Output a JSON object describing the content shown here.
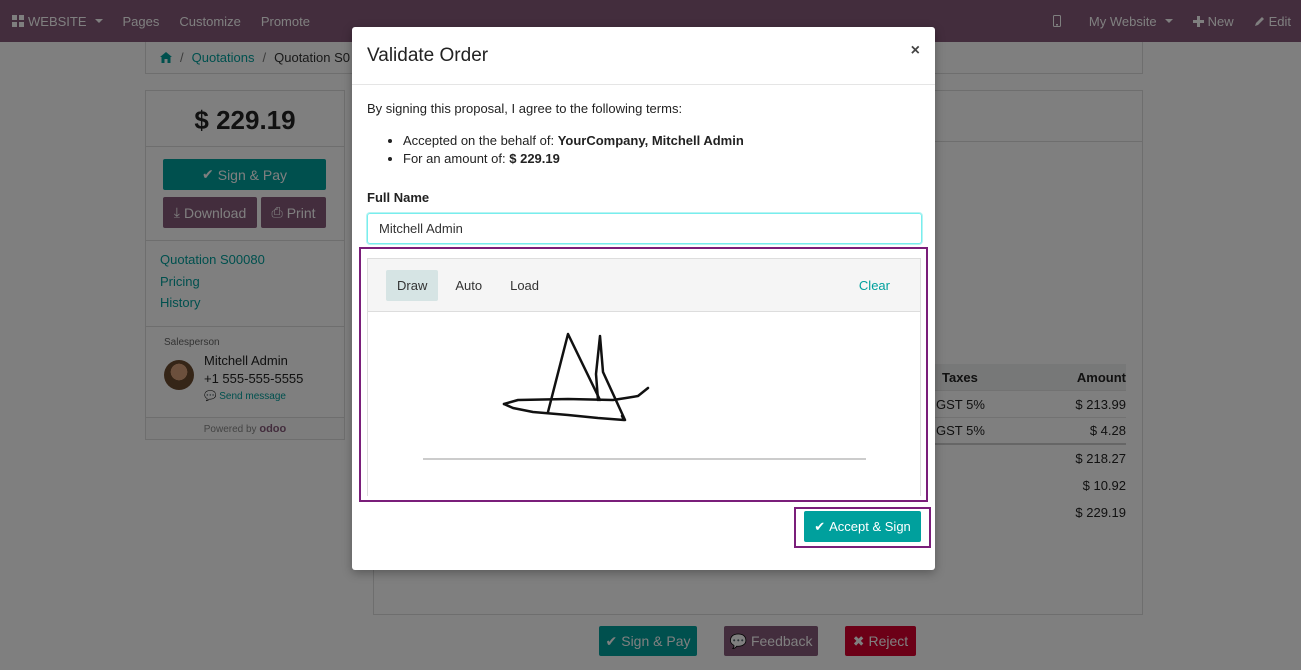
{
  "topbar": {
    "website_menu": "WEBSITE",
    "pages": "Pages",
    "customize": "Customize",
    "promote": "Promote",
    "my_website": "My Website",
    "new": "New",
    "edit": "Edit"
  },
  "breadcrumb": {
    "home_icon": "home-icon",
    "quotations": "Quotations",
    "current": "Quotation S0"
  },
  "sidebar": {
    "total": "$ 229.19",
    "sign_pay": "Sign & Pay",
    "download": "Download",
    "print": "Print",
    "links": [
      "Quotation S00080",
      "Pricing",
      "History"
    ],
    "salesperson_title": "Salesperson",
    "salesperson_name": "Mitchell Admin",
    "salesperson_phone": "+1 555-555-5555",
    "send_message": "Send message",
    "powered_by": "Powered by",
    "powered_brand": "odoo"
  },
  "table": {
    "headers": [
      "Taxes",
      "Amount"
    ],
    "rows": [
      {
        "tax": "GST 5%",
        "amount": "$ 213.99"
      },
      {
        "tax": "GST 5%",
        "amount": "$ 4.28"
      }
    ],
    "totals": [
      "$ 218.27",
      "$ 10.92",
      "$ 229.19"
    ]
  },
  "bottom_buttons": {
    "sign_pay": "Sign & Pay",
    "feedback": "Feedback",
    "reject": "Reject"
  },
  "modal": {
    "title": "Validate Order",
    "close": "×",
    "terms_intro": "By signing this proposal, I agree to the following terms:",
    "behalf_label": "Accepted on the behalf of:",
    "behalf_value": "YourCompany, Mitchell Admin",
    "amount_label": "For an amount of:",
    "amount_value": "$ 229.19",
    "full_name_label": "Full Name",
    "full_name_value": "Mitchell Admin",
    "signature_tabs": [
      "Draw",
      "Auto",
      "Load"
    ],
    "active_tab": "Draw",
    "clear": "Clear",
    "accept_sign": "Accept & Sign"
  },
  "colors": {
    "brand_purple": "#875a7b",
    "accent_teal": "#00a09d",
    "reject_red": "#d9002f",
    "highlight_outline": "#7a1e7a"
  }
}
